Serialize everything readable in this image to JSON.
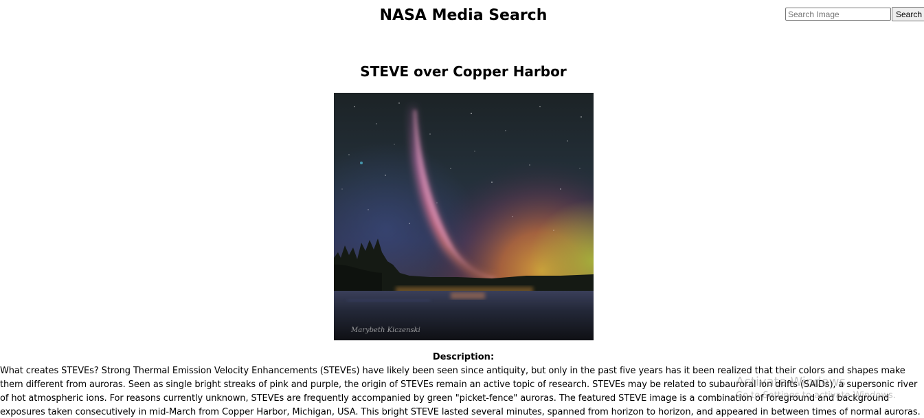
{
  "header": {
    "title": "NASA Media Search",
    "search": {
      "placeholder": "Search Image",
      "value": "",
      "button_label": "Search"
    }
  },
  "article": {
    "title": "STEVE over Copper Harbor",
    "image_credit_signature": "Marybeth Kiczenski",
    "description_heading": "Description:",
    "description": "What creates STEVEs? Strong Thermal Emission Velocity Enhancements (STEVEs) have likely been seen since antiquity, but only in the past five years has it been realized that their colors and shapes make them different from auroras. Seen as single bright streaks of pink and purple, the origin of STEVEs remain an active topic of research. STEVEs may be related to subauroral ion drifts (SAIDs), a supersonic river of hot atmospheric ions. For reasons currently unknown, STEVEs are frequently accompanied by green \"picket-fence\" auroras. The featured STEVE image is a combination of foreground and background exposures taken consecutively in mid-March from Copper Harbor, Michigan, USA. This bright STEVE lasted several minutes, spanned from horizon to horizon, and appeared in between times of normal auroras."
  },
  "overlay": {
    "watermark_title": "Activate Windows",
    "watermark_subtitle": "Go to Settings to activate Windows."
  }
}
